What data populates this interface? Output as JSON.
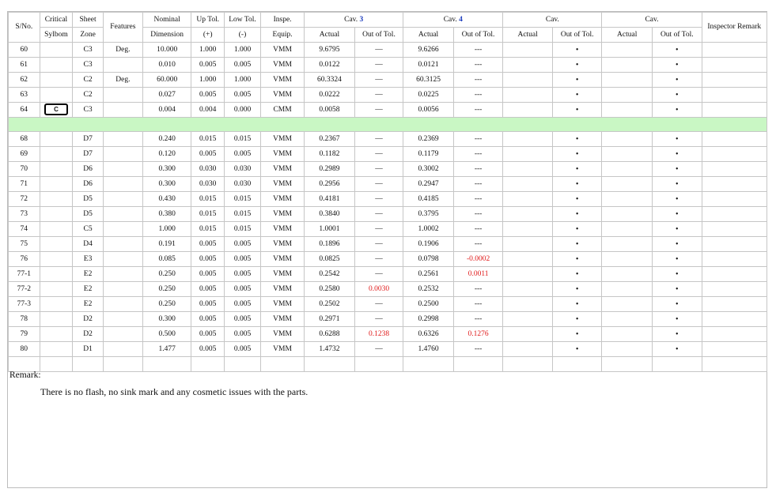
{
  "headers": {
    "sno": "S/No.",
    "critical_top": "Critical",
    "critical_bottom": "Sylbom",
    "sheet_top": "Sheet",
    "sheet_bottom": "Zone",
    "features": "Features",
    "nominal_top": "Nominal",
    "nominal_bottom": "Dimension",
    "uptol_top": "Up Tol.",
    "uptol_bottom": "(+)",
    "lowtol_top": "Low Tol.",
    "lowtol_bottom": "(-)",
    "inspe_top": "Inspe.",
    "inspe_bottom": "Equip.",
    "cav_label": "Cav.",
    "cav3_num": "3",
    "cav4_num": "4",
    "actual": "Actual",
    "out_of_tol": "Out of Tol.",
    "inspector_remark": "Inspector Remark"
  },
  "rows_top": [
    {
      "sno": "60",
      "crit": "",
      "zone": "C3",
      "feat": "Deg.",
      "nom": "10.000",
      "up": "1.000",
      "low": "1.000",
      "eq": "VMM",
      "a3": "9.6795",
      "o3": "—",
      "a4": "9.6266",
      "o4": "---",
      "c5": "•",
      "c6": "•"
    },
    {
      "sno": "61",
      "crit": "",
      "zone": "C3",
      "feat": "",
      "nom": "0.010",
      "up": "0.005",
      "low": "0.005",
      "eq": "VMM",
      "a3": "0.0122",
      "o3": "—",
      "a4": "0.0121",
      "o4": "---",
      "c5": "•",
      "c6": "•"
    },
    {
      "sno": "62",
      "crit": "",
      "zone": "C2",
      "feat": "Deg.",
      "nom": "60.000",
      "up": "1.000",
      "low": "1.000",
      "eq": "VMM",
      "a3": "60.3324",
      "o3": "—",
      "a4": "60.3125",
      "o4": "---",
      "c5": "•",
      "c6": "•"
    },
    {
      "sno": "63",
      "crit": "",
      "zone": "C2",
      "feat": "",
      "nom": "0.027",
      "up": "0.005",
      "low": "0.005",
      "eq": "VMM",
      "a3": "0.0222",
      "o3": "—",
      "a4": "0.0225",
      "o4": "---",
      "c5": "•",
      "c6": "•"
    },
    {
      "sno": "64",
      "crit": "C",
      "zone": "C3",
      "feat": "",
      "nom": "0.004",
      "up": "0.004",
      "low": "0.000",
      "eq": "CMM",
      "a3": "0.0058",
      "o3": "—",
      "a4": "0.0056",
      "o4": "---",
      "c5": "•",
      "c6": "•"
    }
  ],
  "rows_bottom": [
    {
      "sno": "68",
      "zone": "D7",
      "nom": "0.240",
      "up": "0.015",
      "low": "0.015",
      "eq": "VMM",
      "a3": "0.2367",
      "o3": "—",
      "a4": "0.2369",
      "o4": "---",
      "c5": "•",
      "c6": "•"
    },
    {
      "sno": "69",
      "zone": "D7",
      "nom": "0.120",
      "up": "0.005",
      "low": "0.005",
      "eq": "VMM",
      "a3": "0.1182",
      "o3": "—",
      "a4": "0.1179",
      "o4": "---",
      "c5": "•",
      "c6": "•"
    },
    {
      "sno": "70",
      "zone": "D6",
      "nom": "0.300",
      "up": "0.030",
      "low": "0.030",
      "eq": "VMM",
      "a3": "0.2989",
      "o3": "—",
      "a4": "0.3002",
      "o4": "---",
      "c5": "•",
      "c6": "•"
    },
    {
      "sno": "71",
      "zone": "D6",
      "nom": "0.300",
      "up": "0.030",
      "low": "0.030",
      "eq": "VMM",
      "a3": "0.2956",
      "o3": "—",
      "a4": "0.2947",
      "o4": "---",
      "c5": "•",
      "c6": "•"
    },
    {
      "sno": "72",
      "zone": "D5",
      "nom": "0.430",
      "up": "0.015",
      "low": "0.015",
      "eq": "VMM",
      "a3": "0.4181",
      "o3": "—",
      "a4": "0.4185",
      "o4": "---",
      "c5": "•",
      "c6": "•"
    },
    {
      "sno": "73",
      "zone": "D5",
      "nom": "0.380",
      "up": "0.015",
      "low": "0.015",
      "eq": "VMM",
      "a3": "0.3840",
      "o3": "—",
      "a4": "0.3795",
      "o4": "---",
      "c5": "•",
      "c6": "•"
    },
    {
      "sno": "74",
      "zone": "C5",
      "nom": "1.000",
      "up": "0.015",
      "low": "0.015",
      "eq": "VMM",
      "a3": "1.0001",
      "o3": "—",
      "a4": "1.0002",
      "o4": "---",
      "c5": "•",
      "c6": "•"
    },
    {
      "sno": "75",
      "zone": "D4",
      "nom": "0.191",
      "up": "0.005",
      "low": "0.005",
      "eq": "VMM",
      "a3": "0.1896",
      "o3": "—",
      "a4": "0.1906",
      "o4": "---",
      "c5": "•",
      "c6": "•"
    },
    {
      "sno": "76",
      "zone": "E3",
      "nom": "0.085",
      "up": "0.005",
      "low": "0.005",
      "eq": "VMM",
      "a3": "0.0825",
      "o3": "—",
      "a4": "0.0798",
      "o4": "-0.0002",
      "o4_red": true,
      "c5": "•",
      "c6": "•"
    },
    {
      "sno": "77-1",
      "zone": "E2",
      "nom": "0.250",
      "up": "0.005",
      "low": "0.005",
      "eq": "VMM",
      "a3": "0.2542",
      "o3": "—",
      "a4": "0.2561",
      "o4": "0.0011",
      "o4_red": true,
      "c5": "•",
      "c6": "•"
    },
    {
      "sno": "77-2",
      "zone": "E2",
      "nom": "0.250",
      "up": "0.005",
      "low": "0.005",
      "eq": "VMM",
      "a3": "0.2580",
      "o3": "0.0030",
      "o3_red": true,
      "a4": "0.2532",
      "o4": "---",
      "c5": "•",
      "c6": "•"
    },
    {
      "sno": "77-3",
      "zone": "E2",
      "nom": "0.250",
      "up": "0.005",
      "low": "0.005",
      "eq": "VMM",
      "a3": "0.2502",
      "o3": "—",
      "a4": "0.2500",
      "o4": "---",
      "c5": "•",
      "c6": "•"
    },
    {
      "sno": "78",
      "zone": "D2",
      "nom": "0.300",
      "up": "0.005",
      "low": "0.005",
      "eq": "VMM",
      "a3": "0.2971",
      "o3": "—",
      "a4": "0.2998",
      "o4": "---",
      "c5": "•",
      "c6": "•"
    },
    {
      "sno": "79",
      "zone": "D2",
      "nom": "0.500",
      "up": "0.005",
      "low": "0.005",
      "eq": "VMM",
      "a3": "0.6288",
      "o3": "0.1238",
      "o3_red": true,
      "a4": "0.6326",
      "o4": "0.1276",
      "o4_red": true,
      "c5": "•",
      "c6": "•"
    },
    {
      "sno": "80",
      "zone": "D1",
      "nom": "1.477",
      "up": "0.005",
      "low": "0.005",
      "eq": "VMM",
      "a3": "1.4732",
      "o3": "—",
      "a4": "1.4760",
      "o4": "---",
      "c5": "•",
      "c6": "•"
    }
  ],
  "remark": {
    "label": "Remark:",
    "text": "There is no flash, no sink mark and any cosmetic issues with the parts."
  },
  "colors": {
    "separator_row": "#c9f7c4",
    "out_of_tol_highlight": "#e01a1a",
    "cav_number": "#1f3fbf"
  }
}
